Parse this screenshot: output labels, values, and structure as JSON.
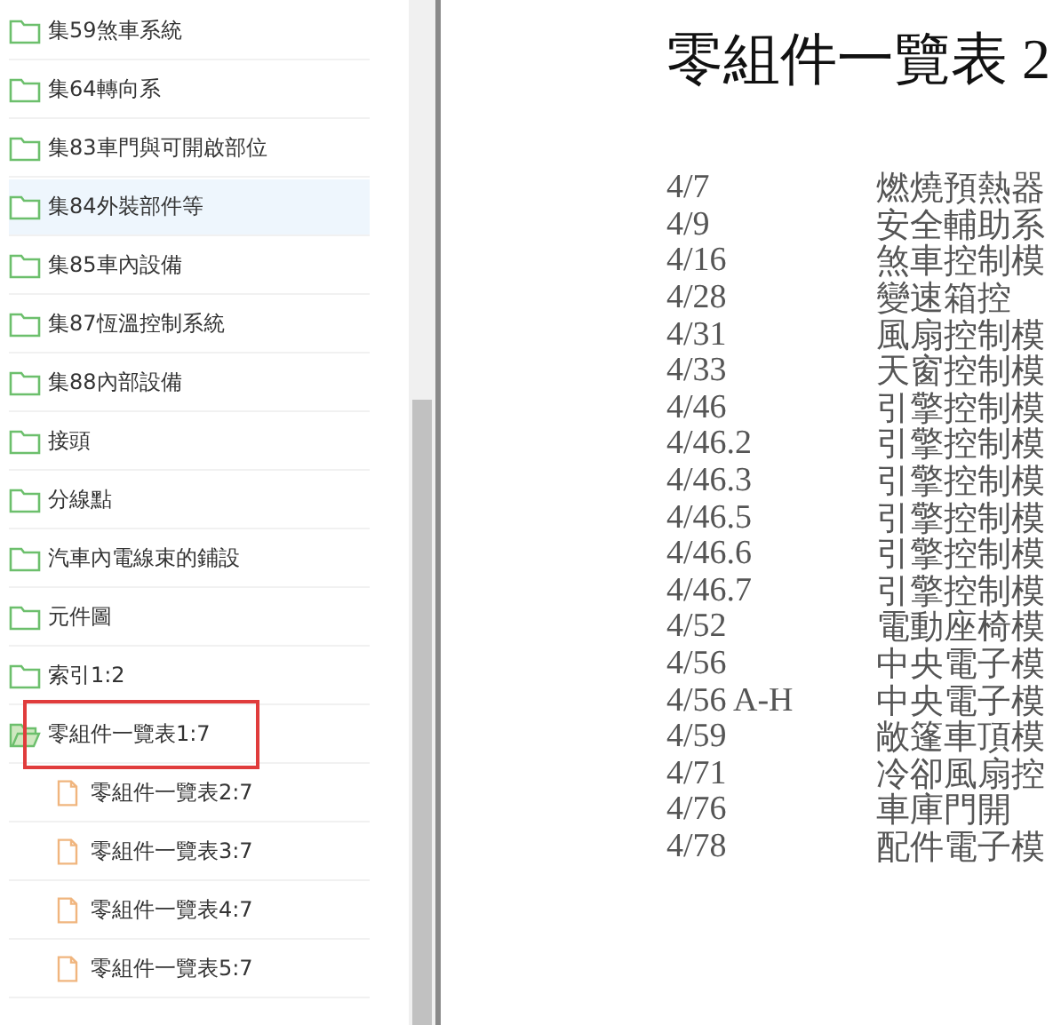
{
  "sidebar": {
    "items": [
      {
        "label": "集59煞車系統",
        "kind": "folder",
        "selected": false
      },
      {
        "label": "集64轉向系",
        "kind": "folder",
        "selected": false
      },
      {
        "label": "集83車門與可開啟部位",
        "kind": "folder",
        "selected": false
      },
      {
        "label": "集84外裝部件等",
        "kind": "folder",
        "selected": true
      },
      {
        "label": "集85車內設備",
        "kind": "folder",
        "selected": false
      },
      {
        "label": "集87恆溫控制系統",
        "kind": "folder",
        "selected": false
      },
      {
        "label": "集88內部設備",
        "kind": "folder",
        "selected": false
      },
      {
        "label": "接頭",
        "kind": "folder",
        "selected": false
      },
      {
        "label": "分線點",
        "kind": "folder",
        "selected": false
      },
      {
        "label": "汽車內電線束的鋪設",
        "kind": "folder",
        "selected": false
      },
      {
        "label": "元件圖",
        "kind": "folder",
        "selected": false
      },
      {
        "label": "索引1:2",
        "kind": "folder",
        "selected": false
      },
      {
        "label": "零組件一覽表1:7",
        "kind": "open-folder",
        "selected": false,
        "marked": true,
        "children": [
          {
            "label": "零組件一覽表2:7",
            "kind": "file",
            "selected": false
          },
          {
            "label": "零組件一覽表3:7",
            "kind": "file",
            "selected": false
          },
          {
            "label": "零組件一覽表4:7",
            "kind": "file",
            "selected": false
          },
          {
            "label": "零組件一覽表5:7",
            "kind": "file",
            "selected": false
          }
        ]
      }
    ]
  },
  "document": {
    "title": "零組件一覽表 2",
    "rows": [
      {
        "code": "4/7",
        "name": "燃燒預熱器"
      },
      {
        "code": "4/9",
        "name": "安全輔助系"
      },
      {
        "code": "4/16",
        "name": "煞車控制模"
      },
      {
        "code": "4/28",
        "name": "變速箱控"
      },
      {
        "code": "4/31",
        "name": "風扇控制模"
      },
      {
        "code": "4/33",
        "name": "天窗控制模"
      },
      {
        "code": "4/46",
        "name": "引擎控制模"
      },
      {
        "code": "4/46.2",
        "name": "引擎控制模"
      },
      {
        "code": "4/46.3",
        "name": "引擎控制模"
      },
      {
        "code": "4/46.5",
        "name": "引擎控制模"
      },
      {
        "code": "4/46.6",
        "name": "引擎控制模"
      },
      {
        "code": "4/46.7",
        "name": "引擎控制模"
      },
      {
        "code": "4/52",
        "name": "電動座椅模"
      },
      {
        "code": "4/56",
        "name": "中央電子模"
      },
      {
        "code": "4/56 A-H",
        "name": "中央電子模"
      },
      {
        "code": "4/59",
        "name": "敞篷車頂模"
      },
      {
        "code": "4/71",
        "name": "冷卻風扇控"
      },
      {
        "code": "4/76",
        "name": "車庫門開"
      },
      {
        "code": "4/78",
        "name": "配件電子模"
      }
    ]
  }
}
